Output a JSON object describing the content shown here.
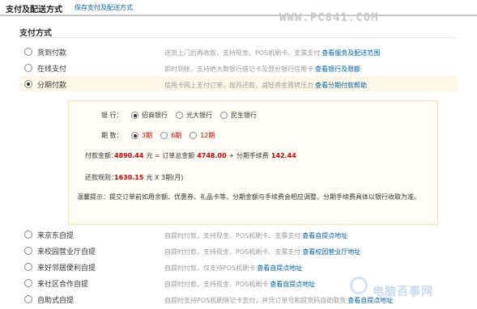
{
  "header": {
    "title": "支付及配送方式",
    "save_link": "保存支付及配送方式"
  },
  "watermark": "WWW.PC841.COM",
  "section": {
    "title": "支付方式"
  },
  "payment_options": [
    {
      "label": "货到付款",
      "desc": "送货上门后再收款，支持现金、POS机刷卡、支票支付",
      "link": "查看服务及配送范围",
      "selected": false
    },
    {
      "label": "在线支付",
      "desc": "即时到帐，支持绝大数银行借记卡及部分银行信用卡",
      "link": "查看银行及限额",
      "selected": false
    },
    {
      "label": "分期付款",
      "desc": "信用卡网上支付订单，按月还款，减轻资金周转压力",
      "link": "查看分期付款帮助",
      "selected": true
    }
  ],
  "installment": {
    "bank_label": "银    行：",
    "banks": [
      {
        "name": "招商银行",
        "selected": true
      },
      {
        "name": "光大银行",
        "selected": false
      },
      {
        "name": "民生银行",
        "selected": false
      }
    ],
    "period_label": "期    数：",
    "periods": [
      {
        "name": "3期",
        "selected": true
      },
      {
        "name": "6期",
        "selected": false
      },
      {
        "name": "12期",
        "selected": false
      }
    ],
    "amount_label": "付款金额：",
    "amount_value": "4890.44",
    "amount_formula_1": "元 = 订单总金额",
    "order_total": "4748.00",
    "amount_formula_2": "+ 分期手续费",
    "fee": "142.44",
    "repay_label": "还款规则：",
    "repay_value": "1630.15",
    "repay_rule": "元 X 3期(月)",
    "tip_label": "温馨提示：",
    "tip_text": "提交订单前如用余额、优惠券、礼品卡等，分期金额与手续费会相应调整，分期手续费具体以银行收取为准。"
  },
  "pickup_options": [
    {
      "label": "来京东自提",
      "desc": "自提时付款，支持现金、POS机刷卡、支票支付",
      "link": "查看自提点地址",
      "selected": false
    },
    {
      "label": "来校园营业厅自提",
      "desc": "自提时付款，支持现金、POS机刷卡、支票支付",
      "link": "查看校园营业厅地址",
      "selected": false
    },
    {
      "label": "来好邻居便利自提",
      "desc": "自提时付款，仅支持POS机刷卡",
      "link": "查看自提点地址",
      "selected": false
    },
    {
      "label": "来社区合作自提",
      "desc": "自提时付款，支持现金、POS机刷卡",
      "link": "查看自提点地址",
      "selected": false
    },
    {
      "label": "自助式自提",
      "desc": "自提时支持POS机刷借记卡支付，并凭订单号和提货码自助取货",
      "link": "查看自提点地址",
      "selected": false
    }
  ],
  "corner_logo": "电脑百事网"
}
